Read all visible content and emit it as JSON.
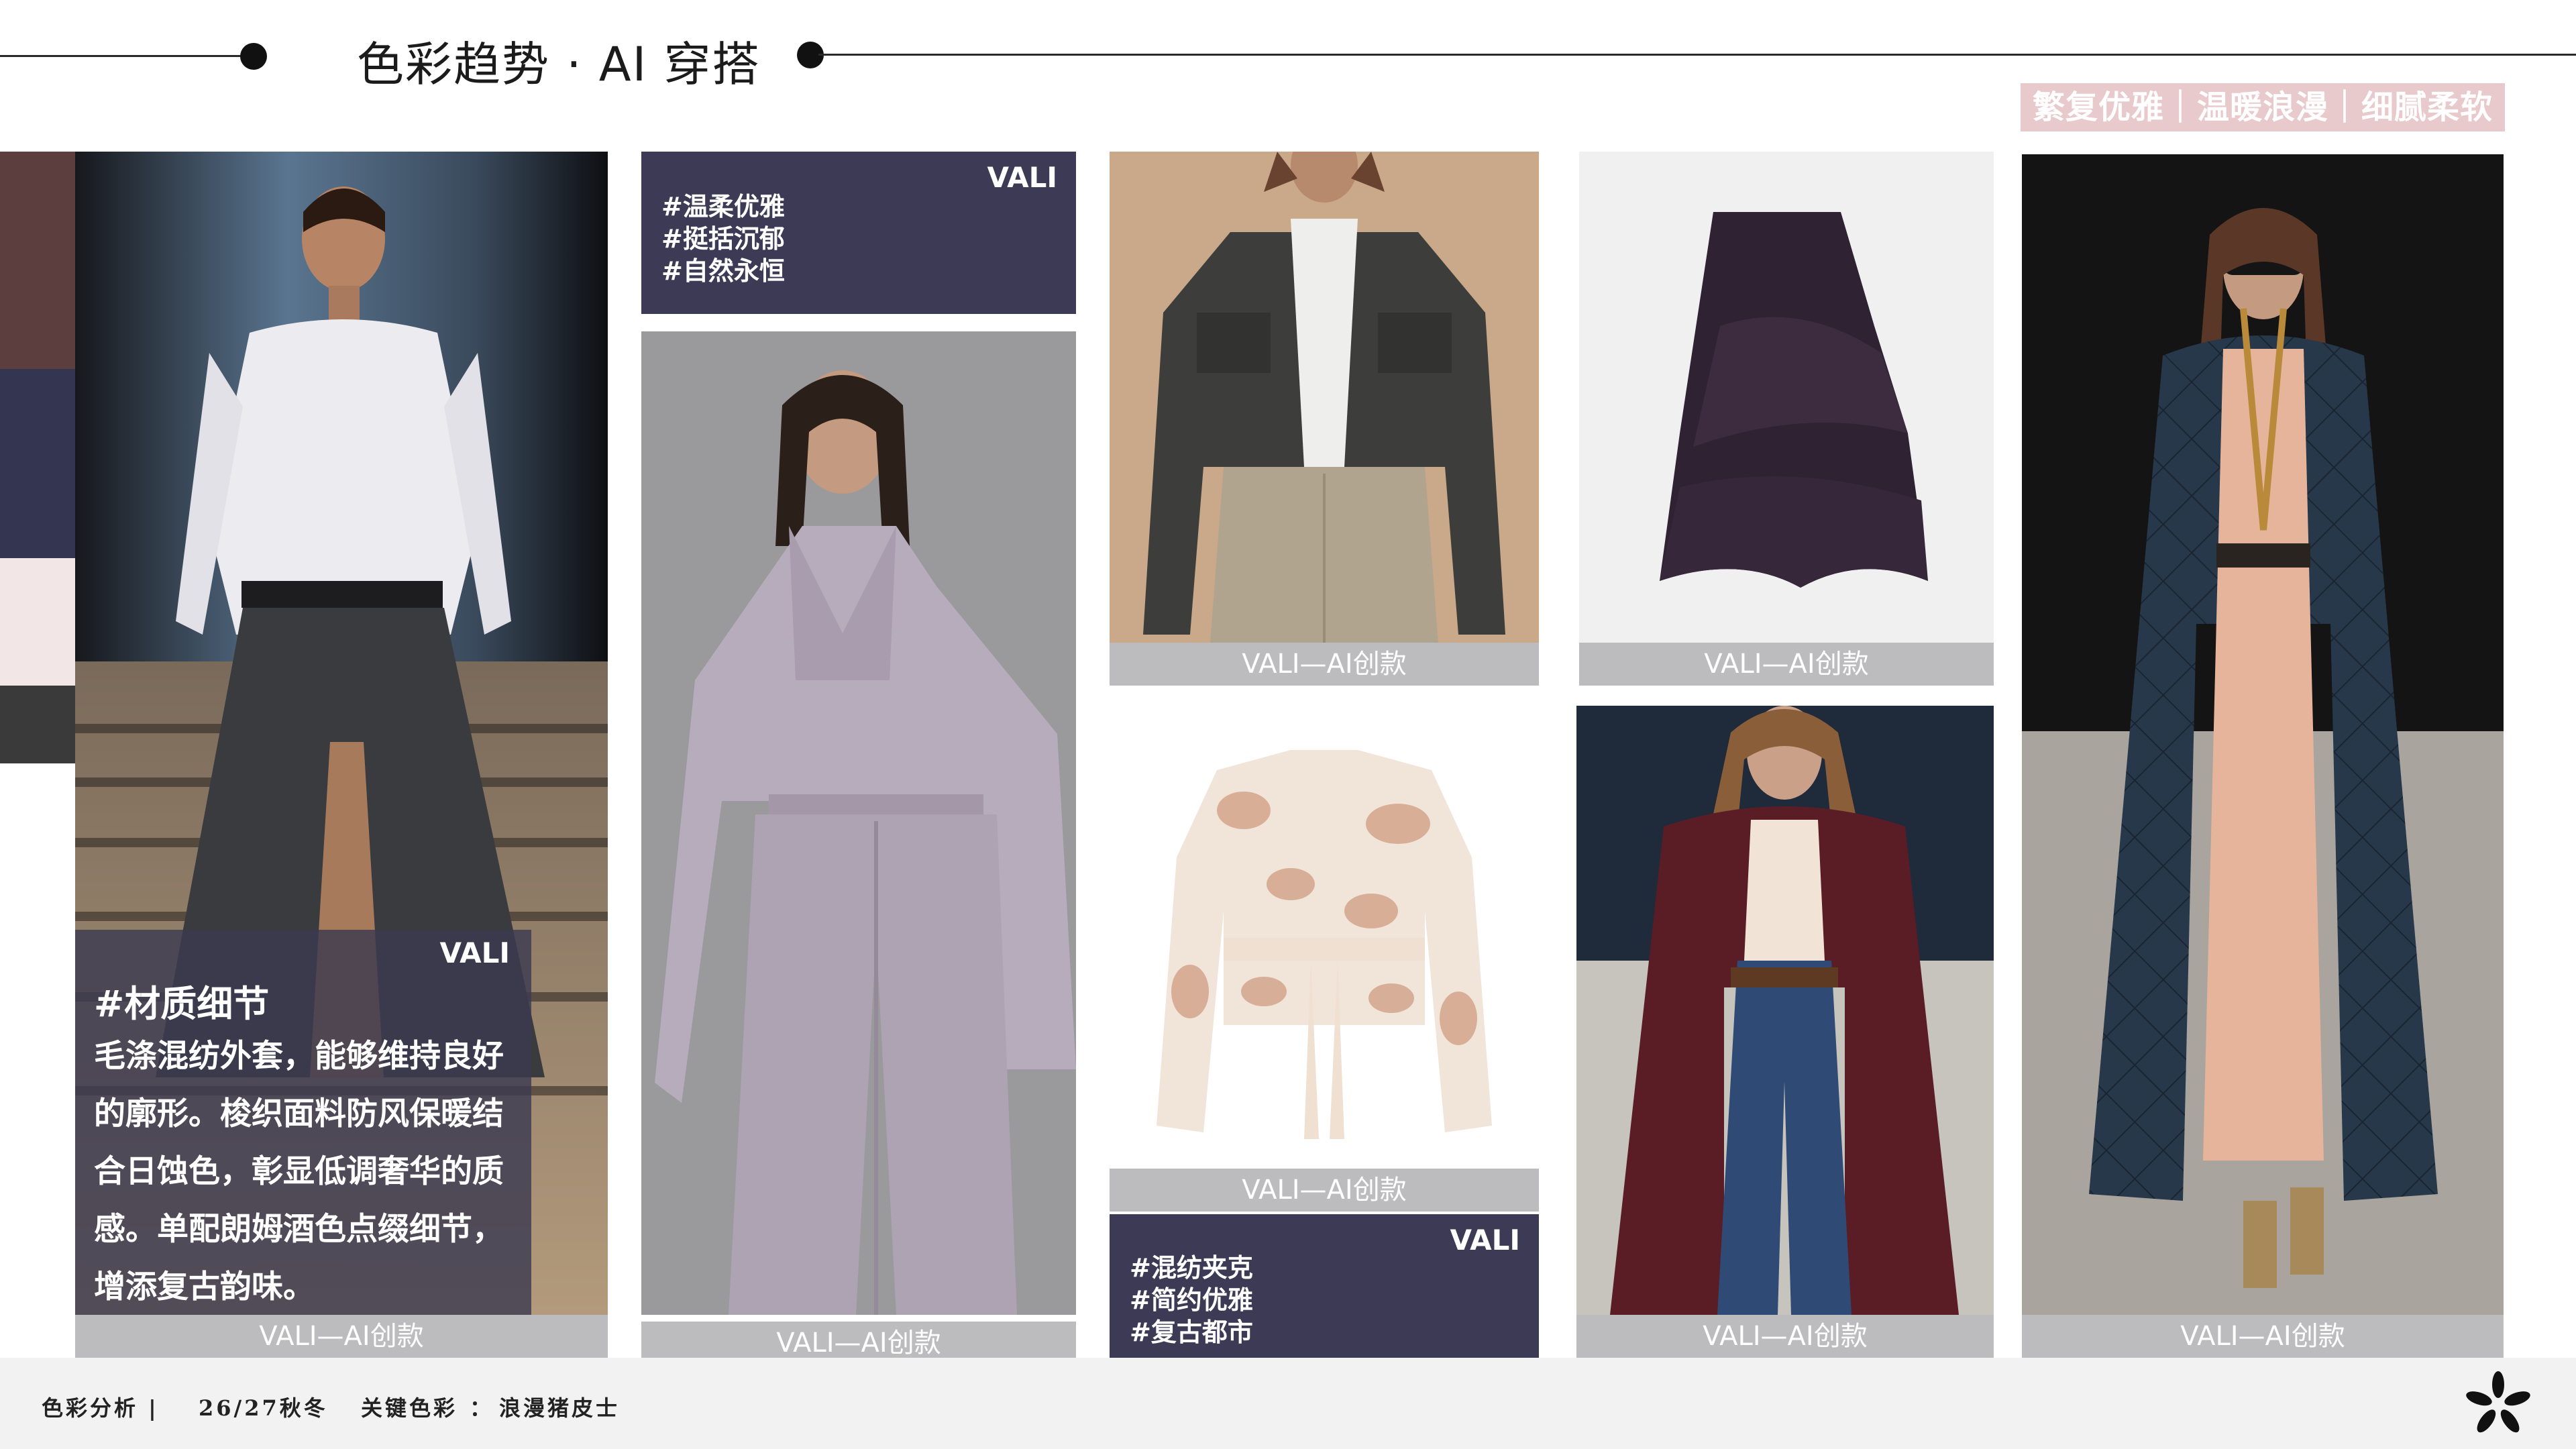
{
  "header": {
    "title": "色彩趋势 · AI 穿搭",
    "keywords": "繁复优雅｜温暖浪漫｜细腻柔软"
  },
  "palette": [
    "#5c3e3e",
    "#343551",
    "#f3e6e6",
    "#3a3a3a"
  ],
  "captions": {
    "c1": "VALI—AI创款",
    "c2": "VALI—AI创款",
    "c3": "VALI—AI创款",
    "c4": "VALI—AI创款",
    "c5": "VALI—AI创款",
    "c6": "VALI—AI创款",
    "c7": "VALI—AI创款"
  },
  "overlay": {
    "brand": "VALI",
    "heading": "#材质细节",
    "body": "毛涤混纺外套，能够维持良好的廓形。梭织面料防风保暖结合日蚀色，彰显低调奢华的质感。单配朗姆酒色点缀细节，增添复古韵味。"
  },
  "tagbox1": {
    "brand": "VALI",
    "tags": [
      "#温柔优雅",
      "#挺括沉郁",
      "#自然永恒"
    ]
  },
  "tagbox2": {
    "brand": "VALI",
    "tags": [
      "#混纺夹克",
      "#简约优雅",
      "#复古都市"
    ]
  },
  "footer": {
    "section": "色彩分析 |",
    "season": "26/27秋冬",
    "topic": "关键色彩",
    "separator": "：",
    "color_name": "浪漫猪皮士"
  },
  "icons": {
    "logo": "asterisk-logo-icon"
  }
}
